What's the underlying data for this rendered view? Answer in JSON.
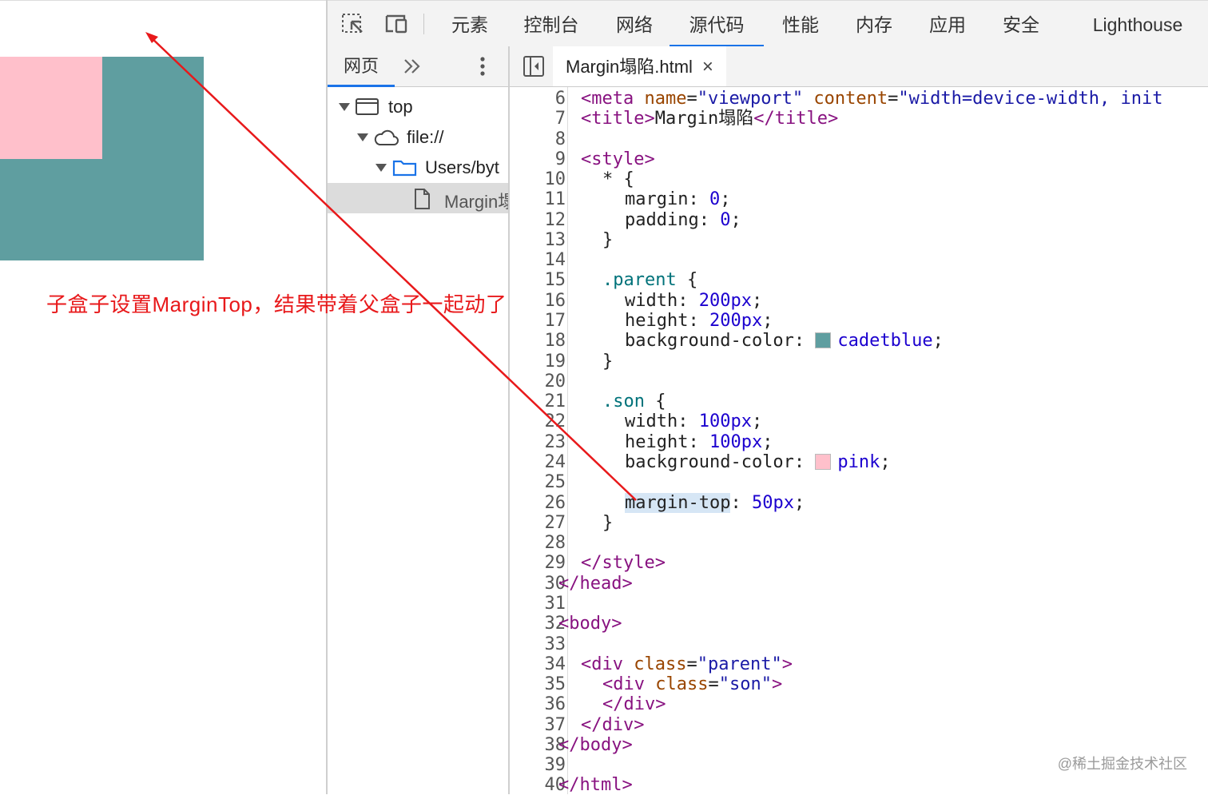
{
  "preview": {
    "parent_color": "#5f9ea0",
    "son_color": "#ffc0cb",
    "annotation": "子盒子设置MarginTop，结果带着父盒子一起动了",
    "annotation_color": "#e8191b"
  },
  "devtools": {
    "tabs": [
      "元素",
      "控制台",
      "网络",
      "源代码",
      "性能",
      "内存",
      "应用",
      "安全",
      "Lighthouse"
    ],
    "active_tab": "源代码",
    "sidebar": {
      "tab_label": "网页",
      "more_icon": "double-chevron-right-icon",
      "tree": [
        {
          "label": "top",
          "icon": "frame-icon"
        },
        {
          "label": "file://",
          "icon": "cloud-icon"
        },
        {
          "label": "Users/byt",
          "icon": "folder-icon"
        },
        {
          "label": "Margin塌",
          "icon": "file-icon"
        }
      ]
    },
    "file_tab": {
      "name": "Margin塌陷.html",
      "close": "×"
    },
    "code": {
      "line_numbers": [
        "6",
        "7",
        "8",
        "9",
        "10",
        "11",
        "12",
        "13",
        "14",
        "15",
        "16",
        "17",
        "18",
        "19",
        "20",
        "21",
        "22",
        "23",
        "24",
        "25",
        "26",
        "27",
        "28",
        "29",
        "30",
        "31",
        "32",
        "33",
        "34",
        "35",
        "36",
        "37",
        "38",
        "39",
        "40"
      ],
      "l6": {
        "t1": "<",
        "tag": "meta",
        "a1": " name",
        "v1": "\"viewport\"",
        "a2": " content",
        "v2": "\"width=device-width, init"
      },
      "l7": {
        "t1": "<",
        "tag": "title",
        "t2": ">",
        "text": "Margin塌陷",
        "t3": "</",
        "tag2": "title",
        "t4": ">"
      },
      "l9": {
        "text": "<style>"
      },
      "l10": {
        "text": "* {"
      },
      "l11": {
        "prop": "margin",
        "val": "0"
      },
      "l12": {
        "prop": "padding",
        "val": "0"
      },
      "l13": {
        "text": "}"
      },
      "l15": {
        "sel": ".parent",
        "brace": " {"
      },
      "l16": {
        "prop": "width",
        "val": "200px"
      },
      "l17": {
        "prop": "height",
        "val": "200px"
      },
      "l18": {
        "prop": "background-color",
        "val": "cadetblue",
        "swatch": "#5f9ea0"
      },
      "l19": {
        "text": "}"
      },
      "l21": {
        "sel": ".son",
        "brace": " {"
      },
      "l22": {
        "prop": "width",
        "val": "100px"
      },
      "l23": {
        "prop": "height",
        "val": "100px"
      },
      "l24": {
        "prop": "background-color",
        "val": "pink",
        "swatch": "#ffc0cb"
      },
      "l26": {
        "prop": "margin-top",
        "val": "50px"
      },
      "l27": {
        "text": "}"
      },
      "l29": {
        "text": "</style>"
      },
      "l30": {
        "text": "</head>"
      },
      "l32": {
        "text": "<body>"
      },
      "l34": {
        "t1": "<",
        "tag": "div",
        "a": " class",
        "v": "\"parent\"",
        "t2": ">"
      },
      "l35": {
        "t1": "<",
        "tag": "div",
        "a": " class",
        "v": "\"son\"",
        "t2": ">"
      },
      "l36": {
        "text": "</div>"
      },
      "l37": {
        "text": "</div>"
      },
      "l38": {
        "text": "</body>"
      },
      "l40": {
        "text": "</html>"
      }
    }
  },
  "watermark": "@稀土掘金技术社区"
}
